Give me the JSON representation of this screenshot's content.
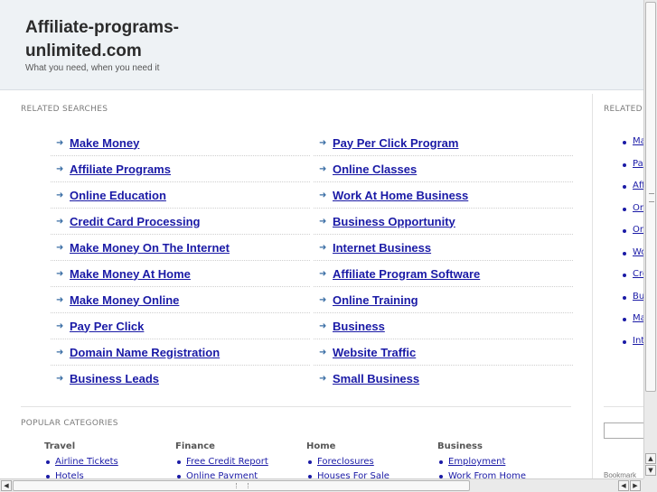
{
  "header": {
    "title": "Affiliate-programs-unlimited.com",
    "tagline": "What you need, when you need it"
  },
  "related_searches": {
    "label": "RELATED SEARCHES",
    "left": [
      "Make Money",
      "Affiliate Programs",
      "Online Education",
      "Credit Card Processing",
      "Make Money On The Internet",
      "Make Money At Home",
      "Make Money Online",
      "Pay Per Click",
      "Domain Name Registration",
      "Business Leads"
    ],
    "right": [
      "Pay Per Click Program",
      "Online Classes",
      "Work At Home Business",
      "Business Opportunity",
      "Internet Business",
      "Affiliate Program Software",
      "Online Training",
      "Business",
      "Website Traffic",
      "Small Business"
    ]
  },
  "popular_categories": {
    "label": "POPULAR CATEGORIES",
    "categories": [
      {
        "name": "Travel",
        "links": [
          "Airline Tickets",
          "Hotels"
        ]
      },
      {
        "name": "Finance",
        "links": [
          "Free Credit Report",
          "Online Payment"
        ]
      },
      {
        "name": "Home",
        "links": [
          "Foreclosures",
          "Houses For Sale"
        ]
      },
      {
        "name": "Business",
        "links": [
          "Employment",
          "Work From Home"
        ]
      }
    ]
  },
  "sidebar": {
    "label": "RELATED",
    "links": [
      "Ma",
      "Pa",
      "Aff",
      "On",
      "On",
      "Wo",
      "Cre",
      "Bu",
      "Ma",
      "Inte"
    ],
    "bookmark": "Bookmark"
  },
  "icons": {
    "row_arrow": "➜",
    "scroll_up": "▲",
    "scroll_down": "▼",
    "scroll_left": "◀",
    "scroll_right": "▶"
  },
  "colors": {
    "link": "#1a1aa6",
    "header_bg": "#eef2f5"
  }
}
